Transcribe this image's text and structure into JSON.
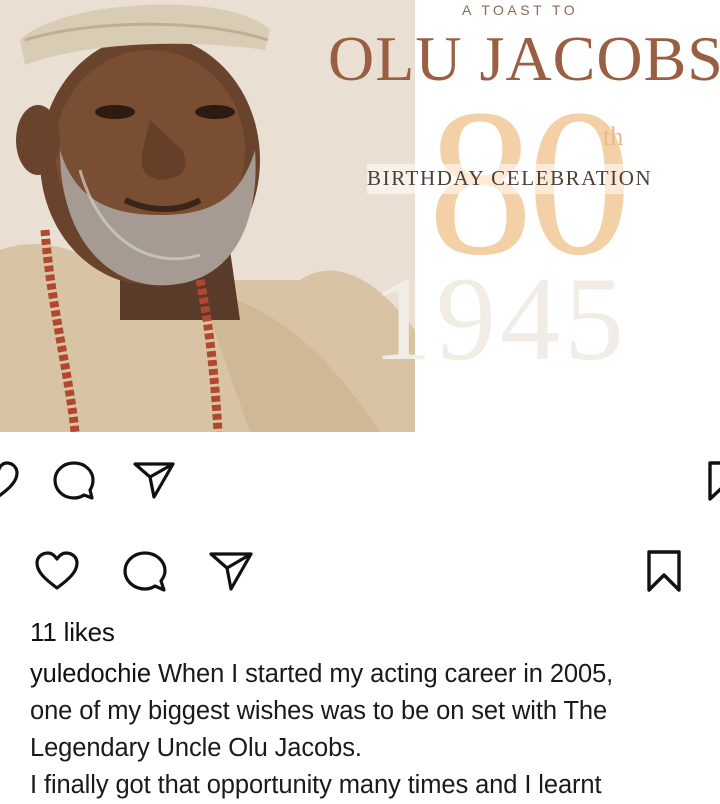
{
  "post_image": {
    "toast_heading": "A TOAST TO",
    "celebrant_name": "OLU JACOBS",
    "age_numeral": "80",
    "age_suffix": "th",
    "celebration_text": "BIRTHDAY CELEBRATION"
  },
  "icons": {
    "like": "heart-icon",
    "comment": "comment-icon",
    "share": "send-icon",
    "save": "bookmark-icon"
  },
  "post": {
    "likes": "11 likes",
    "username": "yuledochie",
    "caption_lines": [
      "When I started my acting career in 2005,",
      "one of my biggest wishes was to be on set with The",
      "Legendary Uncle Olu Jacobs.",
      "I finally got that opportunity many times and I learnt"
    ]
  }
}
